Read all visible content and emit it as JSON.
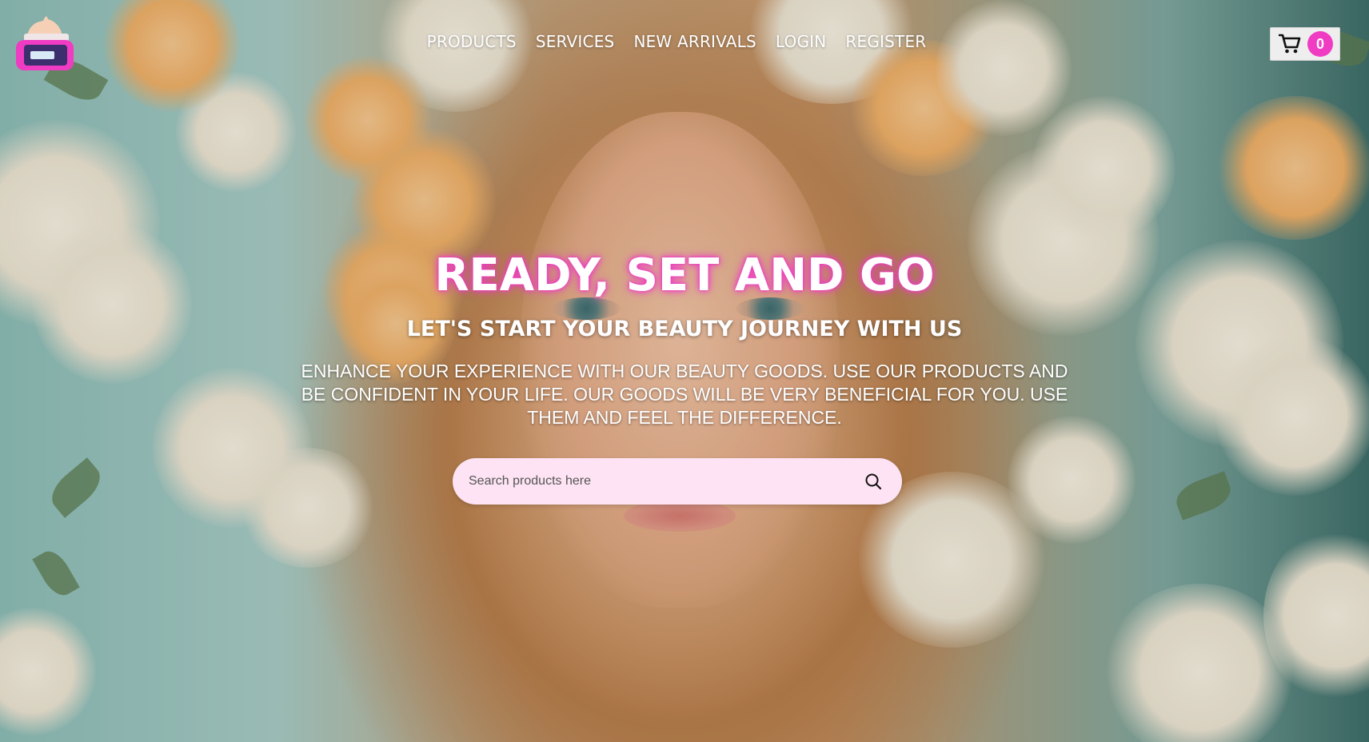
{
  "nav": {
    "items": [
      {
        "label": "PRODUCTS"
      },
      {
        "label": "SERVICES"
      },
      {
        "label": "NEW ARRIVALS"
      },
      {
        "label": "LOGIN"
      },
      {
        "label": "REGISTER"
      }
    ]
  },
  "cart": {
    "icon": "cart-icon",
    "count": "0"
  },
  "logo": {
    "icon": "cream-jar-icon"
  },
  "hero": {
    "title": "READY, SET AND GO",
    "subtitle": "LET'S START YOUR BEAUTY JOURNEY WITH US",
    "description": "ENHANCE YOUR EXPERIENCE WITH OUR BEAUTY GOODS. USE OUR PRODUCTS AND BE CONFIDENT IN YOUR LIFE. OUR GOODS WILL BE VERY BENEFICIAL FOR YOU. USE THEM AND FEEL THE DIFFERENCE."
  },
  "search": {
    "placeholder": "Search products here",
    "value": "",
    "icon": "search-icon"
  },
  "colors": {
    "accent": "#ef3cc3",
    "search_bg": "#fde3f3",
    "cart_bg": "#eeeeee"
  }
}
